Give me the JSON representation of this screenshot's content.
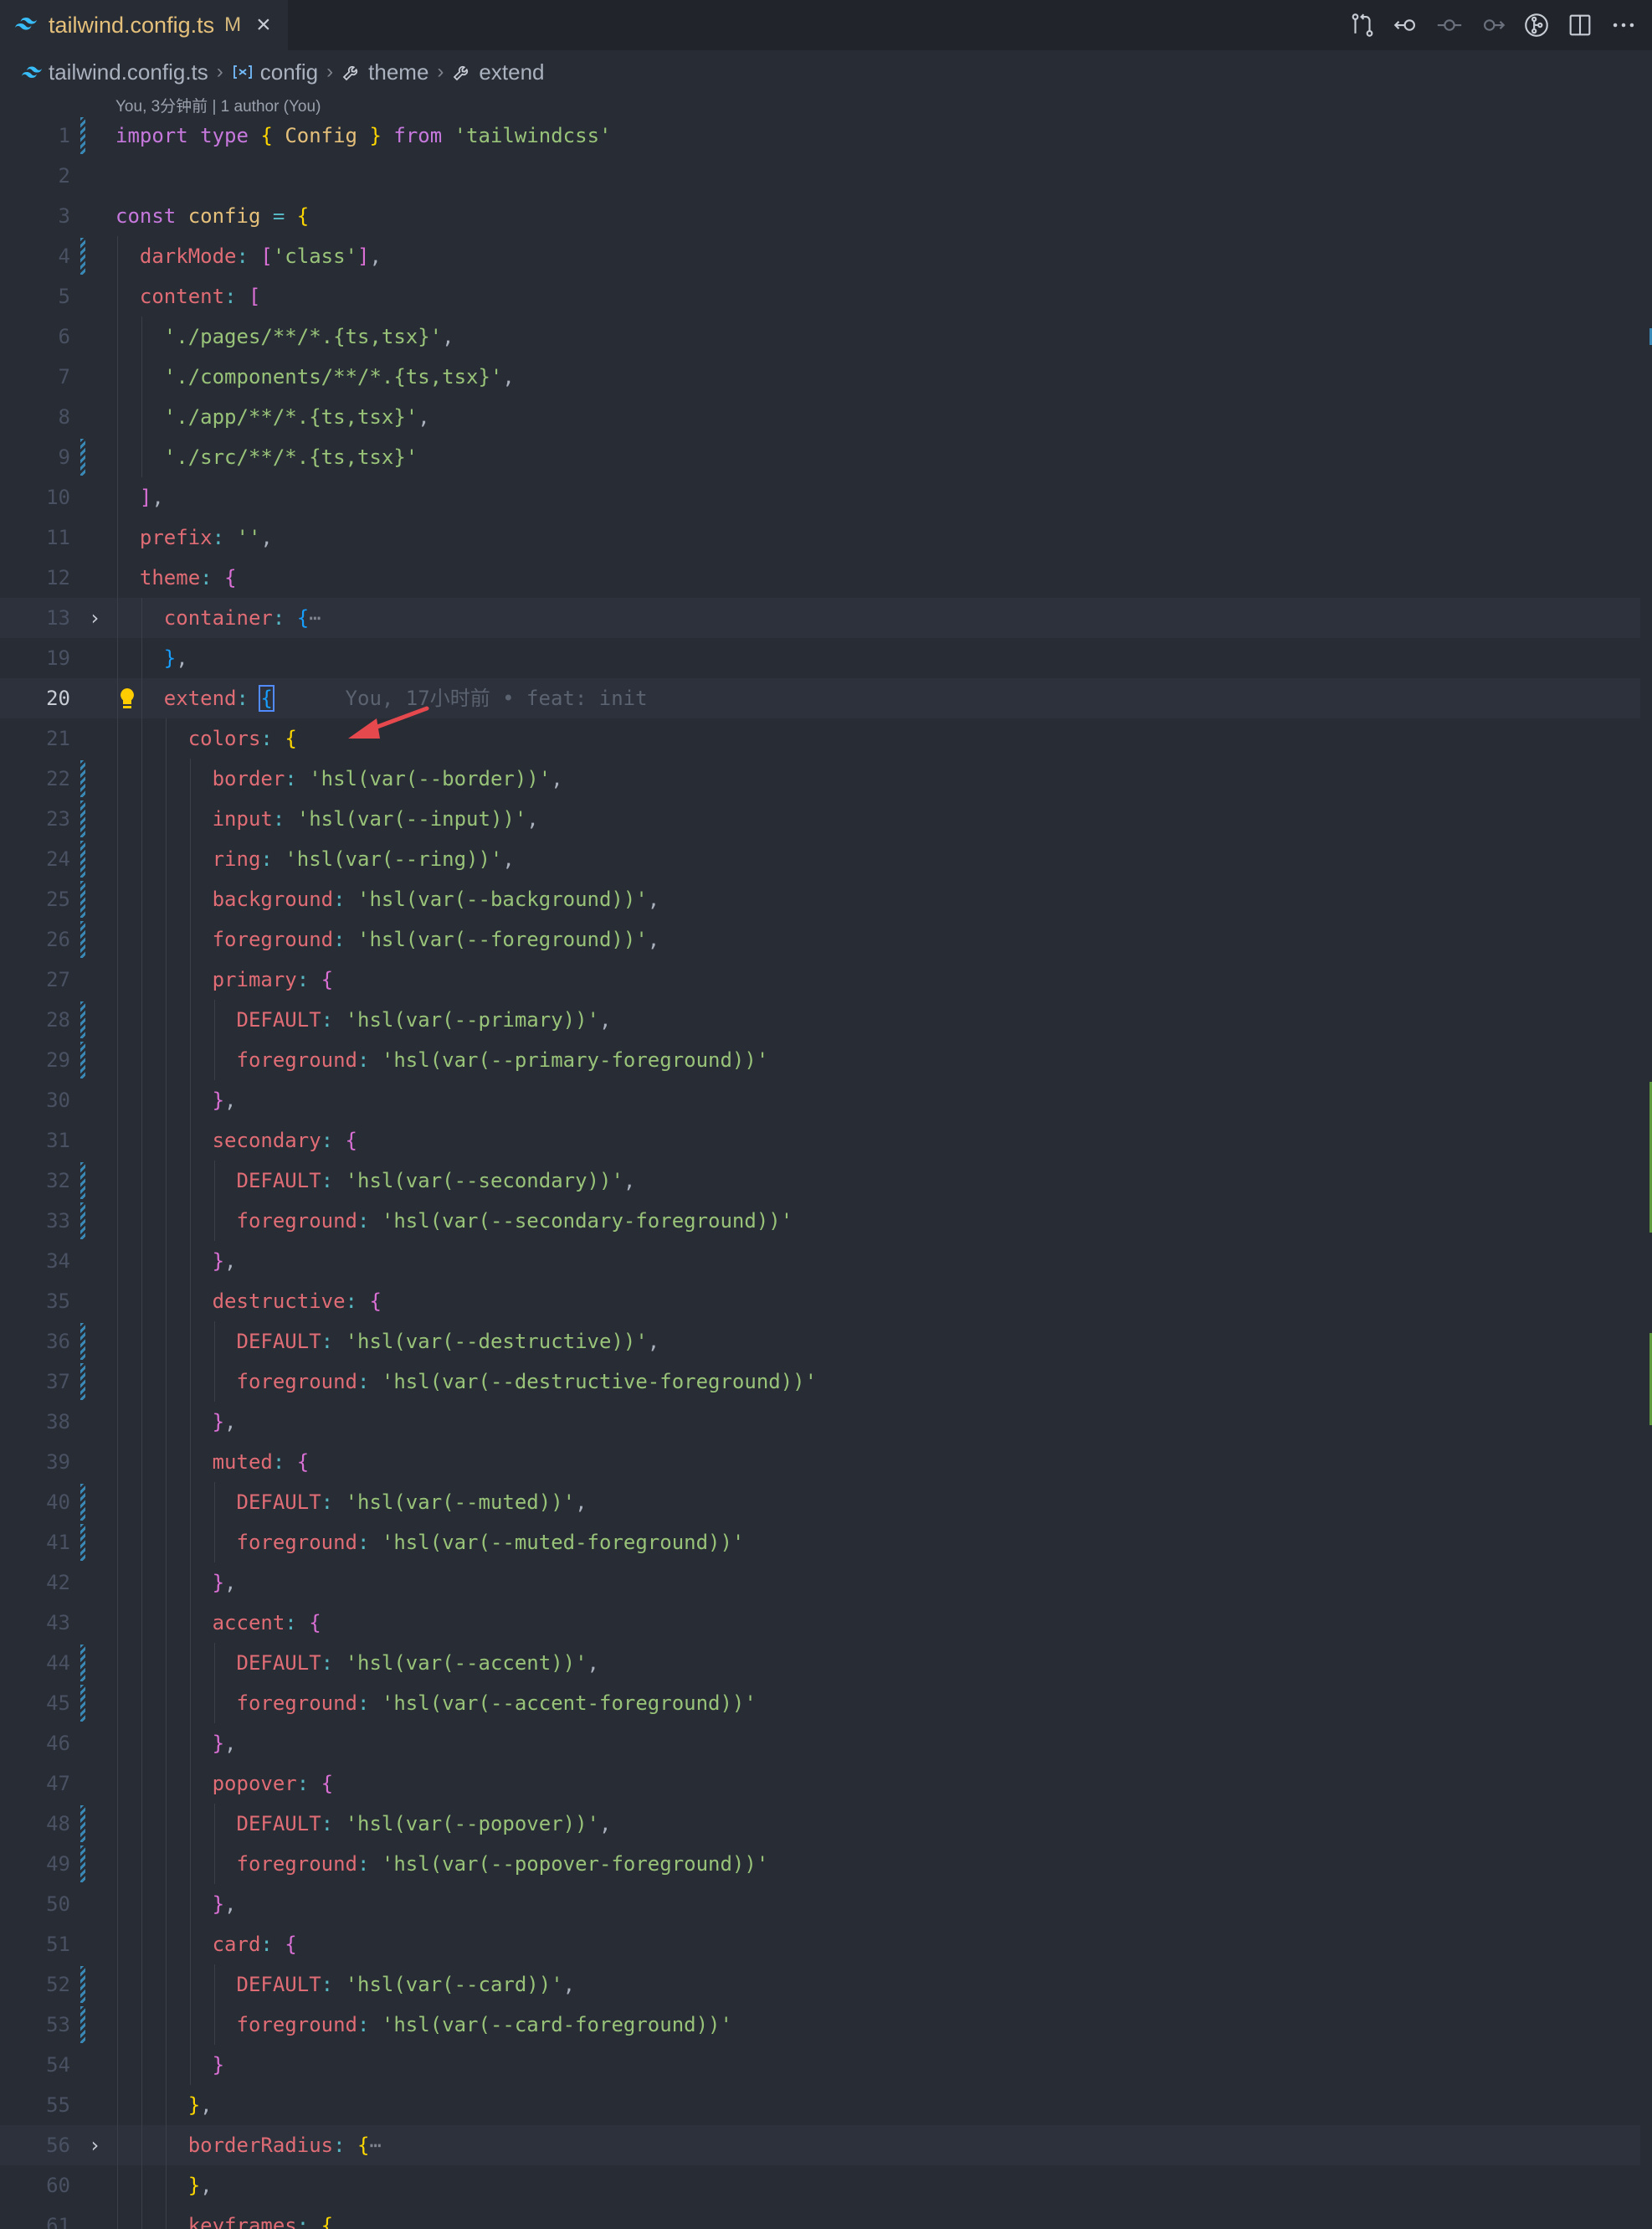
{
  "tab": {
    "title": "tailwind.config.ts",
    "status": "M",
    "close": "×"
  },
  "toolbar": [
    "compare-changes-icon",
    "go-back-icon",
    "commit-icon",
    "go-forward-icon",
    "git-lens-icon",
    "split-editor-icon",
    "more-icon"
  ],
  "breadcrumb": {
    "file": "tailwind.config.ts",
    "items": [
      "config",
      "theme",
      "extend"
    ]
  },
  "blame": "You, 3分钟前 | 1 author (You)",
  "inline_blame": "You, 17小时前 • feat: init",
  "lines": [
    {
      "n": "1",
      "tokens": [
        [
          "k",
          "import"
        ],
        [
          "pu",
          " "
        ],
        [
          "k",
          "type"
        ],
        [
          "pu",
          " "
        ],
        [
          "b1",
          "{"
        ],
        [
          "pu",
          " "
        ],
        [
          "t",
          "Config"
        ],
        [
          "pu",
          " "
        ],
        [
          "b1",
          "}"
        ],
        [
          "pu",
          " "
        ],
        [
          "k",
          "from"
        ],
        [
          "pu",
          " "
        ],
        [
          "s",
          "'tailwindcss'"
        ]
      ]
    },
    {
      "n": "2",
      "tokens": []
    },
    {
      "n": "3",
      "tokens": [
        [
          "k",
          "const"
        ],
        [
          "pu",
          " "
        ],
        [
          "v",
          "config"
        ],
        [
          "pu",
          " "
        ],
        [
          "o",
          "="
        ],
        [
          "pu",
          " "
        ],
        [
          "b1",
          "{"
        ]
      ]
    },
    {
      "n": "4",
      "tokens": [
        [
          "pu",
          "  "
        ],
        [
          "p",
          "darkMode"
        ],
        [
          "o",
          ":"
        ],
        [
          "pu",
          " "
        ],
        [
          "b2",
          "["
        ],
        [
          "s",
          "'class'"
        ],
        [
          "b2",
          "]"
        ],
        [
          "pu",
          ","
        ]
      ]
    },
    {
      "n": "5",
      "tokens": [
        [
          "pu",
          "  "
        ],
        [
          "p",
          "content"
        ],
        [
          "o",
          ":"
        ],
        [
          "pu",
          " "
        ],
        [
          "b2",
          "["
        ]
      ]
    },
    {
      "n": "6",
      "tokens": [
        [
          "pu",
          "    "
        ],
        [
          "s",
          "'./pages/**/*.{ts,tsx}'"
        ],
        [
          "pu",
          ","
        ]
      ]
    },
    {
      "n": "7",
      "tokens": [
        [
          "pu",
          "    "
        ],
        [
          "s",
          "'./components/**/*.{ts,tsx}'"
        ],
        [
          "pu",
          ","
        ]
      ]
    },
    {
      "n": "8",
      "tokens": [
        [
          "pu",
          "    "
        ],
        [
          "s",
          "'./app/**/*.{ts,tsx}'"
        ],
        [
          "pu",
          ","
        ]
      ]
    },
    {
      "n": "9",
      "tokens": [
        [
          "pu",
          "    "
        ],
        [
          "s",
          "'./src/**/*.{ts,tsx}'"
        ]
      ]
    },
    {
      "n": "10",
      "tokens": [
        [
          "pu",
          "  "
        ],
        [
          "b2",
          "]"
        ],
        [
          "pu",
          ","
        ]
      ]
    },
    {
      "n": "11",
      "tokens": [
        [
          "pu",
          "  "
        ],
        [
          "p",
          "prefix"
        ],
        [
          "o",
          ":"
        ],
        [
          "pu",
          " "
        ],
        [
          "s",
          "''"
        ],
        [
          "pu",
          ","
        ]
      ]
    },
    {
      "n": "12",
      "tokens": [
        [
          "pu",
          "  "
        ],
        [
          "p",
          "theme"
        ],
        [
          "o",
          ":"
        ],
        [
          "pu",
          " "
        ],
        [
          "b2",
          "{"
        ]
      ]
    },
    {
      "n": "13",
      "tokens": [
        [
          "pu",
          "    "
        ],
        [
          "p",
          "container"
        ],
        [
          "o",
          ":"
        ],
        [
          "pu",
          " "
        ],
        [
          "b3",
          "{"
        ],
        [
          "fold-dots",
          "⋯"
        ]
      ]
    },
    {
      "n": "19",
      "tokens": [
        [
          "pu",
          "    "
        ],
        [
          "b3",
          "}"
        ],
        [
          "pu",
          ","
        ]
      ]
    },
    {
      "n": "20",
      "tokens": [
        [
          "pu",
          "    "
        ],
        [
          "p",
          "extend"
        ],
        [
          "o",
          ":"
        ],
        [
          "pu",
          " "
        ],
        [
          "b3",
          "{"
        ]
      ]
    },
    {
      "n": "21",
      "tokens": [
        [
          "pu",
          "      "
        ],
        [
          "p",
          "colors"
        ],
        [
          "o",
          ":"
        ],
        [
          "pu",
          " "
        ],
        [
          "b1",
          "{"
        ]
      ]
    },
    {
      "n": "22",
      "tokens": [
        [
          "pu",
          "        "
        ],
        [
          "p",
          "border"
        ],
        [
          "o",
          ":"
        ],
        [
          "pu",
          " "
        ],
        [
          "s",
          "'hsl(var(--border))'"
        ],
        [
          "pu",
          ","
        ]
      ]
    },
    {
      "n": "23",
      "tokens": [
        [
          "pu",
          "        "
        ],
        [
          "p",
          "input"
        ],
        [
          "o",
          ":"
        ],
        [
          "pu",
          " "
        ],
        [
          "s",
          "'hsl(var(--input))'"
        ],
        [
          "pu",
          ","
        ]
      ]
    },
    {
      "n": "24",
      "tokens": [
        [
          "pu",
          "        "
        ],
        [
          "p",
          "ring"
        ],
        [
          "o",
          ":"
        ],
        [
          "pu",
          " "
        ],
        [
          "s",
          "'hsl(var(--ring))'"
        ],
        [
          "pu",
          ","
        ]
      ]
    },
    {
      "n": "25",
      "tokens": [
        [
          "pu",
          "        "
        ],
        [
          "p",
          "background"
        ],
        [
          "o",
          ":"
        ],
        [
          "pu",
          " "
        ],
        [
          "s",
          "'hsl(var(--background))'"
        ],
        [
          "pu",
          ","
        ]
      ]
    },
    {
      "n": "26",
      "tokens": [
        [
          "pu",
          "        "
        ],
        [
          "p",
          "foreground"
        ],
        [
          "o",
          ":"
        ],
        [
          "pu",
          " "
        ],
        [
          "s",
          "'hsl(var(--foreground))'"
        ],
        [
          "pu",
          ","
        ]
      ]
    },
    {
      "n": "27",
      "tokens": [
        [
          "pu",
          "        "
        ],
        [
          "p",
          "primary"
        ],
        [
          "o",
          ":"
        ],
        [
          "pu",
          " "
        ],
        [
          "b2",
          "{"
        ]
      ]
    },
    {
      "n": "28",
      "tokens": [
        [
          "pu",
          "          "
        ],
        [
          "p",
          "DEFAULT"
        ],
        [
          "o",
          ":"
        ],
        [
          "pu",
          " "
        ],
        [
          "s",
          "'hsl(var(--primary))'"
        ],
        [
          "pu",
          ","
        ]
      ]
    },
    {
      "n": "29",
      "tokens": [
        [
          "pu",
          "          "
        ],
        [
          "p",
          "foreground"
        ],
        [
          "o",
          ":"
        ],
        [
          "pu",
          " "
        ],
        [
          "s",
          "'hsl(var(--primary-foreground))'"
        ]
      ]
    },
    {
      "n": "30",
      "tokens": [
        [
          "pu",
          "        "
        ],
        [
          "b2",
          "}"
        ],
        [
          "pu",
          ","
        ]
      ]
    },
    {
      "n": "31",
      "tokens": [
        [
          "pu",
          "        "
        ],
        [
          "p",
          "secondary"
        ],
        [
          "o",
          ":"
        ],
        [
          "pu",
          " "
        ],
        [
          "b2",
          "{"
        ]
      ]
    },
    {
      "n": "32",
      "tokens": [
        [
          "pu",
          "          "
        ],
        [
          "p",
          "DEFAULT"
        ],
        [
          "o",
          ":"
        ],
        [
          "pu",
          " "
        ],
        [
          "s",
          "'hsl(var(--secondary))'"
        ],
        [
          "pu",
          ","
        ]
      ]
    },
    {
      "n": "33",
      "tokens": [
        [
          "pu",
          "          "
        ],
        [
          "p",
          "foreground"
        ],
        [
          "o",
          ":"
        ],
        [
          "pu",
          " "
        ],
        [
          "s",
          "'hsl(var(--secondary-foreground))'"
        ]
      ]
    },
    {
      "n": "34",
      "tokens": [
        [
          "pu",
          "        "
        ],
        [
          "b2",
          "}"
        ],
        [
          "pu",
          ","
        ]
      ]
    },
    {
      "n": "35",
      "tokens": [
        [
          "pu",
          "        "
        ],
        [
          "p",
          "destructive"
        ],
        [
          "o",
          ":"
        ],
        [
          "pu",
          " "
        ],
        [
          "b2",
          "{"
        ]
      ]
    },
    {
      "n": "36",
      "tokens": [
        [
          "pu",
          "          "
        ],
        [
          "p",
          "DEFAULT"
        ],
        [
          "o",
          ":"
        ],
        [
          "pu",
          " "
        ],
        [
          "s",
          "'hsl(var(--destructive))'"
        ],
        [
          "pu",
          ","
        ]
      ]
    },
    {
      "n": "37",
      "tokens": [
        [
          "pu",
          "          "
        ],
        [
          "p",
          "foreground"
        ],
        [
          "o",
          ":"
        ],
        [
          "pu",
          " "
        ],
        [
          "s",
          "'hsl(var(--destructive-foreground))'"
        ]
      ]
    },
    {
      "n": "38",
      "tokens": [
        [
          "pu",
          "        "
        ],
        [
          "b2",
          "}"
        ],
        [
          "pu",
          ","
        ]
      ]
    },
    {
      "n": "39",
      "tokens": [
        [
          "pu",
          "        "
        ],
        [
          "p",
          "muted"
        ],
        [
          "o",
          ":"
        ],
        [
          "pu",
          " "
        ],
        [
          "b2",
          "{"
        ]
      ]
    },
    {
      "n": "40",
      "tokens": [
        [
          "pu",
          "          "
        ],
        [
          "p",
          "DEFAULT"
        ],
        [
          "o",
          ":"
        ],
        [
          "pu",
          " "
        ],
        [
          "s",
          "'hsl(var(--muted))'"
        ],
        [
          "pu",
          ","
        ]
      ]
    },
    {
      "n": "41",
      "tokens": [
        [
          "pu",
          "          "
        ],
        [
          "p",
          "foreground"
        ],
        [
          "o",
          ":"
        ],
        [
          "pu",
          " "
        ],
        [
          "s",
          "'hsl(var(--muted-foreground))'"
        ]
      ]
    },
    {
      "n": "42",
      "tokens": [
        [
          "pu",
          "        "
        ],
        [
          "b2",
          "}"
        ],
        [
          "pu",
          ","
        ]
      ]
    },
    {
      "n": "43",
      "tokens": [
        [
          "pu",
          "        "
        ],
        [
          "p",
          "accent"
        ],
        [
          "o",
          ":"
        ],
        [
          "pu",
          " "
        ],
        [
          "b2",
          "{"
        ]
      ]
    },
    {
      "n": "44",
      "tokens": [
        [
          "pu",
          "          "
        ],
        [
          "p",
          "DEFAULT"
        ],
        [
          "o",
          ":"
        ],
        [
          "pu",
          " "
        ],
        [
          "s",
          "'hsl(var(--accent))'"
        ],
        [
          "pu",
          ","
        ]
      ]
    },
    {
      "n": "45",
      "tokens": [
        [
          "pu",
          "          "
        ],
        [
          "p",
          "foreground"
        ],
        [
          "o",
          ":"
        ],
        [
          "pu",
          " "
        ],
        [
          "s",
          "'hsl(var(--accent-foreground))'"
        ]
      ]
    },
    {
      "n": "46",
      "tokens": [
        [
          "pu",
          "        "
        ],
        [
          "b2",
          "}"
        ],
        [
          "pu",
          ","
        ]
      ]
    },
    {
      "n": "47",
      "tokens": [
        [
          "pu",
          "        "
        ],
        [
          "p",
          "popover"
        ],
        [
          "o",
          ":"
        ],
        [
          "pu",
          " "
        ],
        [
          "b2",
          "{"
        ]
      ]
    },
    {
      "n": "48",
      "tokens": [
        [
          "pu",
          "          "
        ],
        [
          "p",
          "DEFAULT"
        ],
        [
          "o",
          ":"
        ],
        [
          "pu",
          " "
        ],
        [
          "s",
          "'hsl(var(--popover))'"
        ],
        [
          "pu",
          ","
        ]
      ]
    },
    {
      "n": "49",
      "tokens": [
        [
          "pu",
          "          "
        ],
        [
          "p",
          "foreground"
        ],
        [
          "o",
          ":"
        ],
        [
          "pu",
          " "
        ],
        [
          "s",
          "'hsl(var(--popover-foreground))'"
        ]
      ]
    },
    {
      "n": "50",
      "tokens": [
        [
          "pu",
          "        "
        ],
        [
          "b2",
          "}"
        ],
        [
          "pu",
          ","
        ]
      ]
    },
    {
      "n": "51",
      "tokens": [
        [
          "pu",
          "        "
        ],
        [
          "p",
          "card"
        ],
        [
          "o",
          ":"
        ],
        [
          "pu",
          " "
        ],
        [
          "b2",
          "{"
        ]
      ]
    },
    {
      "n": "52",
      "tokens": [
        [
          "pu",
          "          "
        ],
        [
          "p",
          "DEFAULT"
        ],
        [
          "o",
          ":"
        ],
        [
          "pu",
          " "
        ],
        [
          "s",
          "'hsl(var(--card))'"
        ],
        [
          "pu",
          ","
        ]
      ]
    },
    {
      "n": "53",
      "tokens": [
        [
          "pu",
          "          "
        ],
        [
          "p",
          "foreground"
        ],
        [
          "o",
          ":"
        ],
        [
          "pu",
          " "
        ],
        [
          "s",
          "'hsl(var(--card-foreground))'"
        ]
      ]
    },
    {
      "n": "54",
      "tokens": [
        [
          "pu",
          "        "
        ],
        [
          "b2",
          "}"
        ]
      ]
    },
    {
      "n": "55",
      "tokens": [
        [
          "pu",
          "      "
        ],
        [
          "b1",
          "}"
        ],
        [
          "pu",
          ","
        ]
      ]
    },
    {
      "n": "56",
      "tokens": [
        [
          "pu",
          "      "
        ],
        [
          "p",
          "borderRadius"
        ],
        [
          "o",
          ":"
        ],
        [
          "pu",
          " "
        ],
        [
          "b1",
          "{"
        ],
        [
          "fold-dots",
          "⋯"
        ]
      ]
    },
    {
      "n": "60",
      "tokens": [
        [
          "pu",
          "      "
        ],
        [
          "b1",
          "}"
        ],
        [
          "pu",
          ","
        ]
      ]
    },
    {
      "n": "61",
      "tokens": [
        [
          "pu",
          "      "
        ],
        [
          "p",
          "keyframes"
        ],
        [
          "o",
          ":"
        ],
        [
          "pu",
          " "
        ],
        [
          "b1",
          "{"
        ]
      ]
    }
  ],
  "current_line": "20",
  "folded_lines": [
    "13",
    "56"
  ],
  "highlighted_lines": [
    "13",
    "20",
    "56"
  ],
  "git_changed_lines": [
    "1",
    "4",
    "9",
    "22",
    "23",
    "24",
    "25",
    "26",
    "28",
    "29",
    "32",
    "33",
    "36",
    "37",
    "40",
    "41",
    "44",
    "45",
    "48",
    "49",
    "52",
    "53"
  ],
  "colors": {
    "background": "#282c34",
    "tabbar": "#21252b",
    "keyword": "#c678dd",
    "property": "#e06c75",
    "string": "#98c379",
    "git_stripe": "#3a88b6",
    "arrow": "#e5484d"
  }
}
